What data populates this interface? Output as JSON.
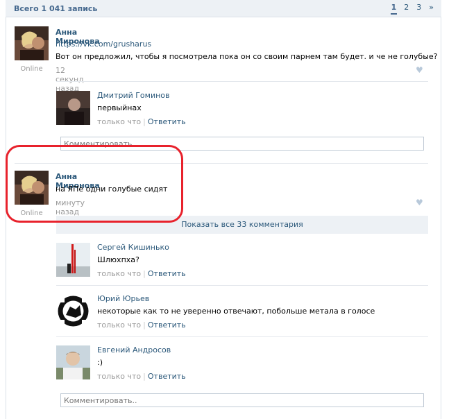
{
  "header": {
    "total": "Всего 1 041 запись",
    "pages": [
      "1",
      "2",
      "3",
      "»"
    ]
  },
  "posts": [
    {
      "author": "Анна Миронова",
      "link": "https://vk.com/grusharus",
      "text": "Вот он предложил, чтобы я посмотрела пока он со своим парнем там будет. и че не голубые?",
      "date": "12 секунд назад",
      "status": "Online"
    },
    {
      "author": "Анна Миронова",
      "text": "на ЯПе одни голубые сидят",
      "date": "минуту назад",
      "status": "Online"
    }
  ],
  "replies": [
    {
      "name": "Дмитрий Гоминов",
      "text": "первыйнах",
      "time": "только что",
      "answer": "Ответить"
    },
    {
      "name": "Сергей Кишинько",
      "text": "Шлюхпха?",
      "time": "только что",
      "answer": "Ответить"
    },
    {
      "name": "Юрий Юрьев",
      "text": "некоторые как то не уверенно отвечают, побольше метала в голосе",
      "time": "только что",
      "answer": "Ответить"
    },
    {
      "name": "Евгений Андросов",
      "text": ":)",
      "time": "только что",
      "answer": "Ответить"
    }
  ],
  "comment_placeholder_1": "Комментировать",
  "comment_placeholder_2": "Комментировать..",
  "show_all": "Показать все 33 комментария",
  "icons": {
    "like": "heart-icon"
  },
  "colors": {
    "link": "#2b587a",
    "header_bg": "#edf1f5",
    "highlight": "#e8222c"
  }
}
